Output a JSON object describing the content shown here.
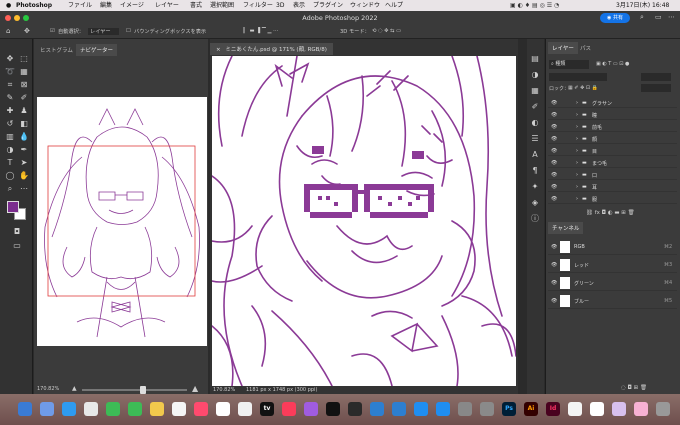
{
  "menubar": {
    "apple": "",
    "app": "Photoshop",
    "items": [
      "ファイル",
      "編集",
      "イメージ",
      "レイヤー",
      "書式",
      "選択範囲",
      "フィルター",
      "3D",
      "表示",
      "プラグイン",
      "ウィンドウ",
      "ヘルプ"
    ],
    "datetime": "3月17日(木)  16:48"
  },
  "titlebar": {
    "title": "Adobe Photoshop 2022",
    "share": "共有"
  },
  "options": {
    "auto_select": "自動選択：",
    "target": "レイヤー",
    "bbox": "バウンディングボックスを表示",
    "mode_3d": "3D モード："
  },
  "navigator": {
    "tabs": [
      "ヒストグラム",
      "ナビゲーター"
    ],
    "zoom": "170.82%"
  },
  "document": {
    "tab": "ミニあくたん.psd @ 171% (顔, RGB/8)",
    "zoom": "170.82%",
    "info": "1181 px x 1748 px (300 ppi)"
  },
  "layers_panel": {
    "tabs": [
      "レイヤー",
      "パス"
    ],
    "filter": "種類",
    "lock_label": "ロック：",
    "layers": [
      "グラサン",
      "瞳",
      "前毛",
      "顔",
      "目",
      "まつ毛",
      "口",
      "耳",
      "服"
    ]
  },
  "channels_panel": {
    "tab": "チャンネル",
    "channels": [
      {
        "name": "RGB",
        "shortcut": "⌘2"
      },
      {
        "name": "レッド",
        "shortcut": "⌘3"
      },
      {
        "name": "グリーン",
        "shortcut": "⌘4"
      },
      {
        "name": "ブルー",
        "shortcut": "⌘5"
      }
    ]
  },
  "colors": {
    "accent": "#7b2d8e",
    "line": "#8b3a96"
  },
  "dock": {
    "apps": [
      {
        "label": "",
        "color": "#3a7bd5"
      },
      {
        "label": "",
        "color": "#6f9be8"
      },
      {
        "label": "",
        "color": "#2e9bf0"
      },
      {
        "label": "",
        "color": "#e8e8e8"
      },
      {
        "label": "",
        "color": "#3dbb56"
      },
      {
        "label": "",
        "color": "#3dbb56"
      },
      {
        "label": "",
        "color": "#f2c94c"
      },
      {
        "label": "",
        "color": "#f5f5f5"
      },
      {
        "label": "",
        "color": "#ff4a6e"
      },
      {
        "label": "",
        "color": "#ffffff"
      },
      {
        "label": "",
        "color": "#f0f0f0"
      },
      {
        "label": "tv",
        "color": "#111111"
      },
      {
        "label": "",
        "color": "#fb3c5a"
      },
      {
        "label": "",
        "color": "#a05ce0"
      },
      {
        "label": "",
        "color": "#111111"
      },
      {
        "label": "",
        "color": "#2a2a2a"
      },
      {
        "label": "",
        "color": "#2d7fd0"
      },
      {
        "label": "",
        "color": "#2d7fd0"
      },
      {
        "label": "",
        "color": "#1f8ef1"
      },
      {
        "label": "",
        "color": "#1f8ef1"
      },
      {
        "label": "",
        "color": "#888888"
      },
      {
        "label": "",
        "color": "#8a8a8a"
      },
      {
        "label": "Ps",
        "color": "#001e36"
      },
      {
        "label": "Ai",
        "color": "#330000"
      },
      {
        "label": "Id",
        "color": "#49021f"
      },
      {
        "label": "",
        "color": "#f4f4f4"
      },
      {
        "label": "",
        "color": "#ffffff"
      },
      {
        "label": "",
        "color": "#d8c0ee"
      },
      {
        "label": "",
        "color": "#f7b1d3"
      },
      {
        "label": "",
        "color": "#999999"
      }
    ]
  }
}
